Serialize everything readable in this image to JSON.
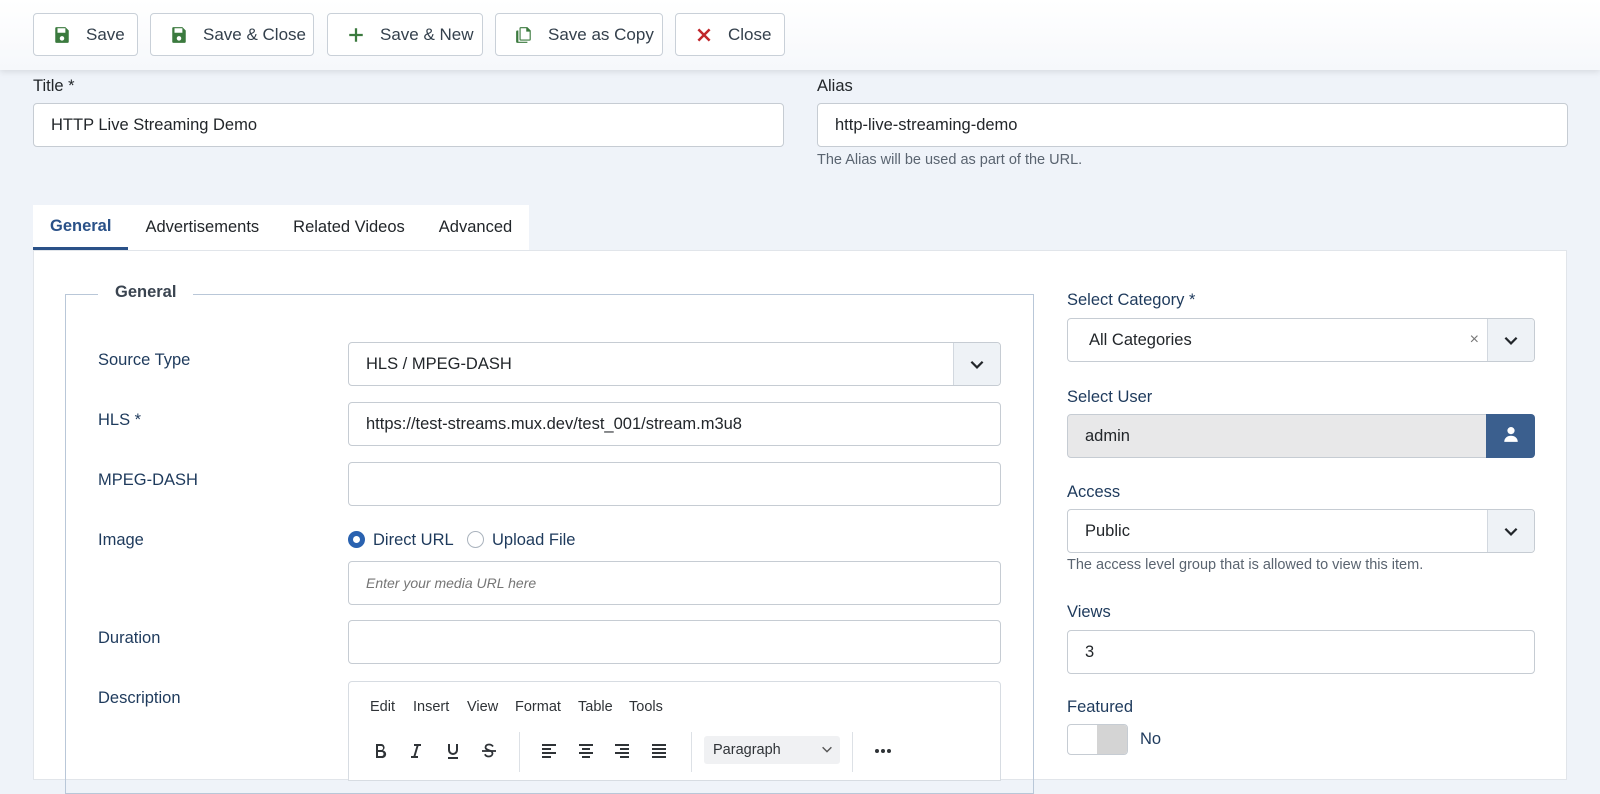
{
  "toolbar": {
    "save_label": "Save",
    "save_close_label": "Save & Close",
    "save_new_label": "Save & New",
    "save_copy_label": "Save as Copy",
    "close_label": "Close"
  },
  "header": {
    "title_label": "Title *",
    "title_value": "HTTP Live Streaming Demo",
    "alias_label": "Alias",
    "alias_value": "http-live-streaming-demo",
    "alias_hint": "The Alias will be used as part of the URL."
  },
  "tabs": [
    {
      "label": "General",
      "active": true
    },
    {
      "label": "Advertisements",
      "active": false
    },
    {
      "label": "Related Videos",
      "active": false
    },
    {
      "label": "Advanced",
      "active": false
    }
  ],
  "general": {
    "legend": "General",
    "source_type_label": "Source Type",
    "source_type_value": "HLS / MPEG-DASH",
    "hls_label": "HLS *",
    "hls_value": "https://test-streams.mux.dev/test_001/stream.m3u8",
    "mpeg_dash_label": "MPEG-DASH",
    "mpeg_dash_value": "",
    "image_label": "Image",
    "image_options": [
      {
        "label": "Direct URL",
        "checked": true
      },
      {
        "label": "Upload File",
        "checked": false
      }
    ],
    "image_placeholder": "Enter your media URL here",
    "duration_label": "Duration",
    "duration_value": "",
    "description_label": "Description"
  },
  "editor": {
    "menu": [
      "Edit",
      "Insert",
      "View",
      "Format",
      "Table",
      "Tools"
    ],
    "block_format": "Paragraph"
  },
  "sidebar": {
    "category_label": "Select Category *",
    "category_value": "All Categories",
    "clear_symbol": "×",
    "user_label": "Select User",
    "user_value": "admin",
    "access_label": "Access",
    "access_value": "Public",
    "access_hint": "The access level group that is allowed to view this item.",
    "views_label": "Views",
    "views_value": "3",
    "featured_label": "Featured",
    "featured_value": "No"
  },
  "colors": {
    "accent": "#2a5188",
    "save_icon": "#3b7a3e",
    "close_icon": "#c0262b",
    "user_button": "#3b5f8e"
  }
}
